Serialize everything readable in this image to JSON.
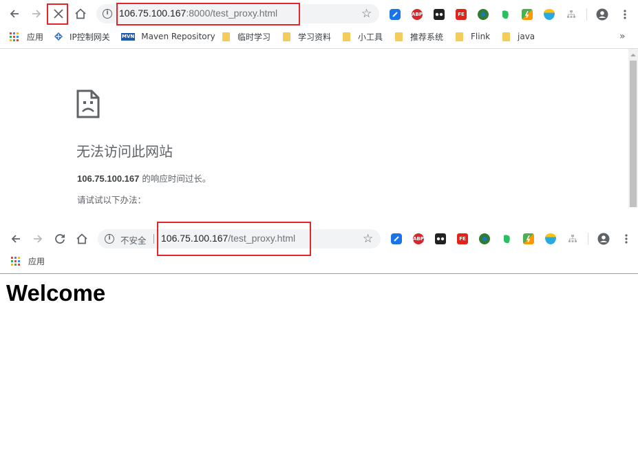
{
  "top_window": {
    "url_host": "106.75.100.167",
    "url_rest": ":8000/test_proxy.html",
    "bookmarks": [
      {
        "label": "应用",
        "icon": "apps-grid-icon"
      },
      {
        "label": "IP控制网关",
        "icon": "network-icon"
      },
      {
        "label": "Maven Repository",
        "icon": "mvn-icon"
      },
      {
        "label": "临时学习",
        "icon": "folder-icon"
      },
      {
        "label": "学习资料",
        "icon": "folder-icon"
      },
      {
        "label": "小工具",
        "icon": "folder-icon"
      },
      {
        "label": "推荐系统",
        "icon": "folder-icon"
      },
      {
        "label": "Flink",
        "icon": "folder-icon"
      },
      {
        "label": "java",
        "icon": "folder-icon"
      }
    ],
    "overflow_label": "»",
    "error": {
      "title": "无法访问此网站",
      "host_bold": "106.75.100.167",
      "message": " 的响应时间过长。",
      "suggestion": "请试试以下办法："
    }
  },
  "bottom_window": {
    "security_label": "不安全",
    "url_host": "106.75.100.167",
    "url_rest": "/test_proxy.html",
    "bookmarks": [
      {
        "label": "应用",
        "icon": "apps-grid-icon"
      }
    ],
    "heading": "Welcome"
  },
  "extensions": [
    "bookmark-ext",
    "ABP",
    "tampermonkey-ext",
    "FE",
    "ie-tab-ext",
    "evernote-ext",
    "proxy-switcher-ext",
    "shield-ext",
    "sitemap-ext"
  ],
  "colors": {
    "highlight_red": "#e0262b",
    "toolbar_icon": "#5f6368",
    "folder": "#f5cc5a"
  }
}
